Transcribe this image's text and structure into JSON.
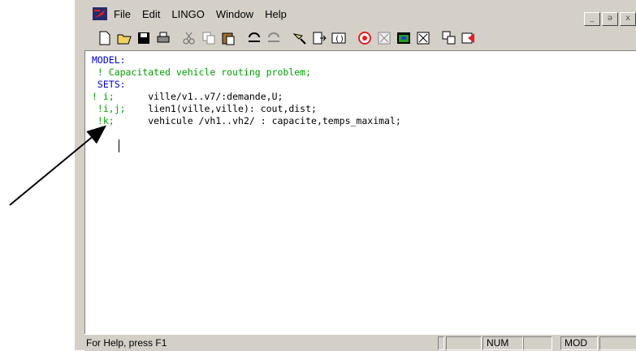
{
  "menu": {
    "items": [
      "File",
      "Edit",
      "LINGO",
      "Window",
      "Help"
    ]
  },
  "window_buttons": {
    "minimize": "_",
    "restore": "ə",
    "close": "x"
  },
  "toolbar": {
    "icons": [
      "new-icon",
      "open-icon",
      "save-icon",
      "print-icon",
      "cut-icon",
      "copy-icon",
      "paste-icon",
      "undo-icon",
      "redo-icon",
      "find-icon",
      "goto-line-icon",
      "match-paren-icon",
      "solve-icon",
      "solution-icon",
      "matrix-picture-icon",
      "close-all-icon",
      "tile-icon",
      "options-icon"
    ]
  },
  "editor": {
    "lines": [
      {
        "parts": [
          {
            "cls": "kw",
            "text": "MODEL:"
          }
        ]
      },
      {
        "parts": [
          {
            "cls": "cm",
            "text": " ! Capacitated vehicle routing problem;"
          }
        ]
      },
      {
        "parts": [
          {
            "cls": "kw",
            "text": " SETS:"
          }
        ]
      },
      {
        "parts": [
          {
            "cls": "cm",
            "text": "! i;"
          },
          {
            "cls": "tx",
            "text": "      ville/v1..v7/:demande,U;"
          }
        ]
      },
      {
        "parts": [
          {
            "cls": "cm",
            "text": " !i,j;"
          },
          {
            "cls": "tx",
            "text": "    lien1(ville,ville): cout,dist;"
          }
        ]
      },
      {
        "parts": [
          {
            "cls": "cm",
            "text": " !k;"
          },
          {
            "cls": "tx",
            "text": "      vehicule /vh1..vh2/ : capacite,temps_maximal;"
          }
        ]
      }
    ]
  },
  "statusbar": {
    "help_text": "For Help, press F1",
    "num": "NUM",
    "mod": "MOD"
  }
}
